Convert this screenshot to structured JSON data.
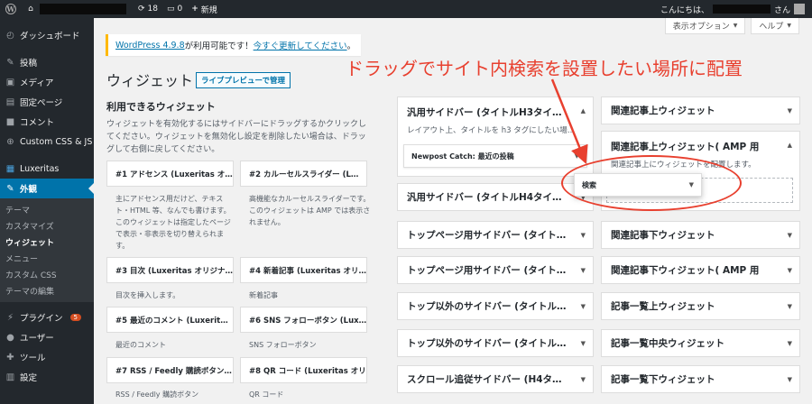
{
  "adminbar": {
    "update_count": "18",
    "comment_count": "0",
    "new_label": "新規",
    "greeting_prefix": "こんにちは、",
    "greeting_suffix": "さん"
  },
  "screen_options": {
    "screen_options_label": "表示オプション",
    "help_label": "ヘルプ"
  },
  "sidebar": {
    "items": [
      {
        "label": "ダッシュボード",
        "icon": "dashboard-icon"
      },
      {
        "label": "投稿",
        "icon": "pin-icon"
      },
      {
        "label": "メディア",
        "icon": "media-icon"
      },
      {
        "label": "固定ページ",
        "icon": "page-icon"
      },
      {
        "label": "コメント",
        "icon": "comment-icon"
      },
      {
        "label": "Custom CSS & JS",
        "icon": "plus-circle-icon"
      },
      {
        "label": "Luxeritas",
        "icon": "grid-icon"
      },
      {
        "label": "外観",
        "icon": "brush-icon"
      }
    ],
    "appearance_sub": [
      "テーマ",
      "カスタマイズ",
      "ウィジェット",
      "メニュー",
      "カスタム CSS",
      "テーマの編集"
    ],
    "bottom_items": [
      {
        "label": "プラグイン",
        "icon": "plug-icon",
        "badge": "5"
      },
      {
        "label": "ユーザー",
        "icon": "user-icon"
      },
      {
        "label": "ツール",
        "icon": "wrench-icon"
      },
      {
        "label": "設定",
        "icon": "settings-icon"
      }
    ]
  },
  "notice": {
    "version_link": "WordPress 4.9.8",
    "text": " が利用可能です！",
    "update_link": "今すぐ更新してください",
    "end": "。"
  },
  "page": {
    "title": "ウィジェット",
    "live_preview_label": "ライブプレビューで管理"
  },
  "annotation": "ドラッグでサイト内検索を設置したい場所に配置",
  "available": {
    "title": "利用できるウィジェット",
    "description": "ウィジェットを有効化するにはサイドバーにドラッグするかクリックしてください。ウィジェットを無効化し設定を削除したい場合は、ドラッグして右側に戻してください。",
    "widgets": [
      {
        "name": "#1 アドセンス (Luxeritas オ…",
        "desc": "主にアドセンス用だけど、テキスト・HTML 等、なんでも書けます。このウィジェットは指定したページで表示・非表示を切り替えられます。"
      },
      {
        "name": "#2 カルーセルスライダー (L…",
        "desc": "高機能なカルーセルスライダーです。このウィジェットは AMP では表示されません。"
      },
      {
        "name": "#3 目次 (Luxeritas オリジナ…",
        "desc": "目次を挿入します。"
      },
      {
        "name": "#4 新着記事 (Luxeritas オリ…",
        "desc": "新着記事"
      },
      {
        "name": "#5 最近のコメント (Luxerit…",
        "desc": "最近のコメント"
      },
      {
        "name": "#6 SNS フォローボタン (Lux…",
        "desc": "SNS フォローボタン"
      },
      {
        "name": "#7 RSS / Feedly 購読ボタン…",
        "desc": "RSS / Feedly 購読ボタン"
      },
      {
        "name": "#8 QR コード (Luxeritas オリ…",
        "desc": "QR コード"
      }
    ]
  },
  "areas_left": [
    {
      "title": "汎用サイドバー (タイトルH3タイ…",
      "desc": "レイアウト上、タイトルを h3 タグにしたい場…",
      "inner_widget": "Newpost Catch: 最近の投稿"
    },
    {
      "title": "汎用サイドバー (タイトルH4タイ…"
    },
    {
      "title": "トップページ用サイドバー (タイト…"
    },
    {
      "title": "トップページ用サイドバー (タイト…"
    },
    {
      "title": "トップ以外のサイドバー (タイトル…"
    },
    {
      "title": "トップ以外のサイドバー (タイトル…"
    },
    {
      "title": "スクロール追従サイドバー (H4タ…"
    }
  ],
  "areas_right": [
    {
      "title": "関連記事上ウィジェット"
    },
    {
      "title": "関連記事上ウィジェット( AMP 用",
      "desc": "関連記事上にウィジェットを配置します。"
    },
    {
      "title": "関連記事下ウィジェット"
    },
    {
      "title": "関連記事下ウィジェット( AMP 用"
    },
    {
      "title": "記事一覧上ウィジェット"
    },
    {
      "title": "記事一覧中央ウィジェット"
    },
    {
      "title": "記事一覧下ウィジェット"
    }
  ],
  "dragged_widget": "検索",
  "colors": {
    "admin_dark": "#23282d",
    "admin_blue": "#0073aa",
    "notice_yellow": "#ffb900",
    "annotation_red": "#e8402f"
  }
}
